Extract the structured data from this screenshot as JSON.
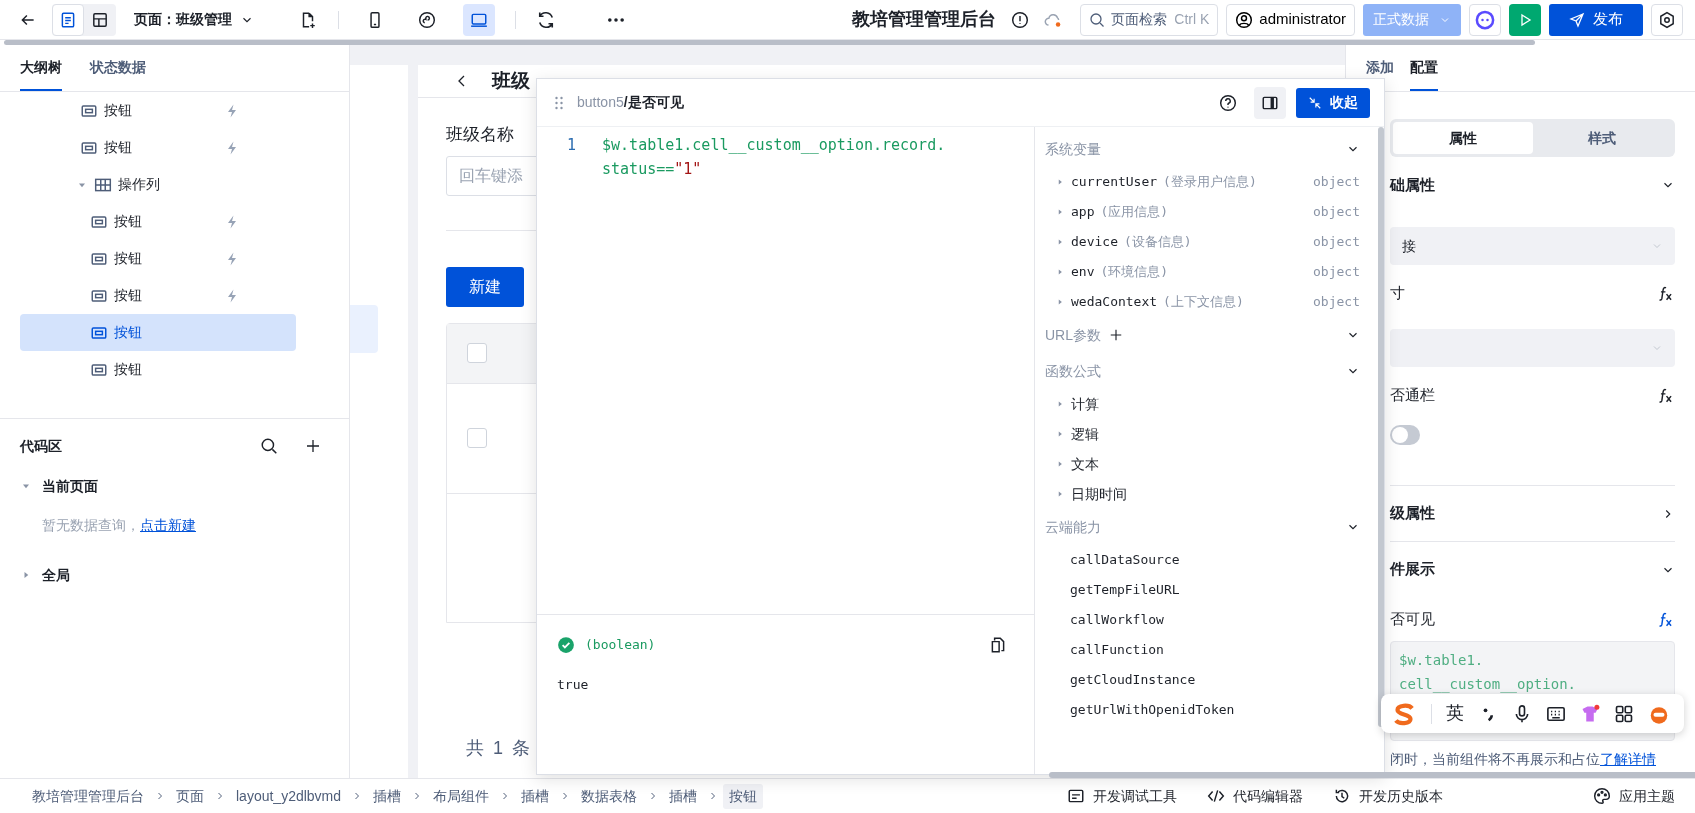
{
  "topbar": {
    "view_modes": [
      {
        "kind": "outline",
        "selected": true
      },
      {
        "kind": "layout",
        "selected": false
      }
    ],
    "page_select": "页面：班级管理",
    "devices": [
      {
        "kind": "mobile",
        "selected": false
      },
      {
        "kind": "miniprogram",
        "selected": false
      },
      {
        "kind": "desktop",
        "selected": true
      }
    ],
    "app_title": "教培管理管理后台",
    "search": {
      "placeholder": "页面检索",
      "shortcut": "Ctrl K"
    },
    "user": "administrator",
    "data_env": "正式数据",
    "publish": "发布"
  },
  "left_panel": {
    "tabs": [
      {
        "label": "大纲树",
        "selected": true
      },
      {
        "label": "状态数据",
        "selected": false
      }
    ],
    "outline": [
      {
        "kind": "button",
        "label": "按钮",
        "event": true,
        "selected": false
      },
      {
        "kind": "button",
        "label": "按钮",
        "event": true,
        "selected": false
      },
      {
        "kind": "column",
        "label": "操作列",
        "event": false,
        "selected": false,
        "expanded": true,
        "children": [
          {
            "kind": "button",
            "label": "按钮",
            "event": true,
            "selected": false
          },
          {
            "kind": "button",
            "label": "按钮",
            "event": true,
            "selected": false
          },
          {
            "kind": "button",
            "label": "按钮",
            "event": true,
            "selected": false
          },
          {
            "kind": "button",
            "label": "按钮",
            "event": false,
            "selected": true
          },
          {
            "kind": "button",
            "label": "按钮",
            "event": false,
            "selected": false
          }
        ]
      }
    ],
    "code_area": {
      "title": "代码区",
      "groups": [
        {
          "label": "当前页面",
          "expanded": true,
          "empty_text": "暂无数据查询，",
          "link": "点击新建"
        },
        {
          "label": "全局",
          "expanded": false
        }
      ]
    }
  },
  "canvas": {
    "title": "班级",
    "field_label": "班级名称",
    "field_placeholder": "回车键添",
    "new_button": "新建",
    "table": {
      "header_checked": false,
      "rows": [
        {
          "checked": false
        }
      ]
    },
    "footer": "共 1 条"
  },
  "expression_editor": {
    "path": "button5",
    "title": "/是否可见",
    "collapse_button": "收起",
    "line_number": "1",
    "tokens": [
      {
        "kind": "expr",
        "text": "$w.table1.cell__custom__option.record.status=="
      },
      {
        "kind": "string",
        "text": "\"1\""
      }
    ],
    "result": {
      "ok": true,
      "type": "(boolean)",
      "value": "true"
    },
    "sections": [
      {
        "title": "系统变量",
        "addable": false,
        "items": [
          {
            "name": "currentUser",
            "desc": "(登录用户信息)",
            "type": "object",
            "expandable": true
          },
          {
            "name": "app",
            "desc": "(应用信息)",
            "type": "object",
            "expandable": true
          },
          {
            "name": "device",
            "desc": "(设备信息)",
            "type": "object",
            "expandable": true
          },
          {
            "name": "env",
            "desc": "(环境信息)",
            "type": "object",
            "expandable": true
          },
          {
            "name": "wedaContext",
            "desc": "(上下文信息)",
            "type": "object",
            "expandable": true
          }
        ]
      },
      {
        "title": "URL参数",
        "addable": true
      },
      {
        "title": "函数公式",
        "addable": false,
        "items": [
          {
            "name": "计算",
            "expandable": true
          },
          {
            "name": "逻辑",
            "expandable": true
          },
          {
            "name": "文本",
            "expandable": true
          },
          {
            "name": "日期时间",
            "expandable": true
          }
        ]
      },
      {
        "title": "云端能力",
        "addable": false,
        "items": [
          {
            "name": "callDataSource",
            "expandable": false
          },
          {
            "name": "getTempFileURL",
            "expandable": false
          },
          {
            "name": "callWorkflow",
            "expandable": false
          },
          {
            "name": "callFunction",
            "expandable": false
          },
          {
            "name": "getCloudInstance",
            "expandable": false
          },
          {
            "name": "getUrlWithOpenidToken",
            "expandable": false
          }
        ]
      }
    ]
  },
  "right_panel": {
    "tabs": [
      {
        "label": "添加",
        "selected": false
      },
      {
        "label": "配置",
        "selected": true
      }
    ],
    "segments": [
      {
        "label": "属性",
        "selected": true
      },
      {
        "label": "样式",
        "selected": false
      }
    ],
    "rows": [
      {
        "kind": "group",
        "label": "础属性",
        "expanded": true
      },
      {
        "kind": "select",
        "value": "接"
      },
      {
        "kind": "label",
        "label": "寸",
        "bound": false
      },
      {
        "kind": "select"
      },
      {
        "kind": "label",
        "label": "否通栏",
        "bound": false
      },
      {
        "kind": "switch",
        "on": false
      },
      {
        "kind": "group",
        "label": "级属性",
        "expanded": false
      },
      {
        "kind": "group",
        "label": "件展示",
        "expanded": true
      },
      {
        "kind": "label",
        "label": "否可见",
        "bound": true
      },
      {
        "kind": "preview",
        "lines": [
          "$w.table1.",
          "cell__custom__option."
        ]
      },
      {
        "kind": "hint",
        "text": "闭时，当前组件将不再展示和占位",
        "link": "了解详情"
      }
    ]
  },
  "ime_toolbar": {
    "mode": "英"
  },
  "status_bar": {
    "breadcrumbs": [
      {
        "label": "教培管理管理后台",
        "selected": false
      },
      {
        "label": "页面",
        "selected": false
      },
      {
        "label": "layout_y2dlbvmd",
        "selected": false
      },
      {
        "label": "插槽",
        "selected": false
      },
      {
        "label": "布局组件",
        "selected": false
      },
      {
        "label": "插槽",
        "selected": false
      },
      {
        "label": "数据表格",
        "selected": false
      },
      {
        "label": "插槽",
        "selected": false
      },
      {
        "label": "按钮",
        "selected": true
      }
    ],
    "tools": [
      {
        "kind": "debug",
        "label": "开发调试工具"
      },
      {
        "kind": "code",
        "label": "代码编辑器"
      },
      {
        "kind": "history",
        "label": "开发历史版本"
      }
    ],
    "theme": "应用主题"
  }
}
